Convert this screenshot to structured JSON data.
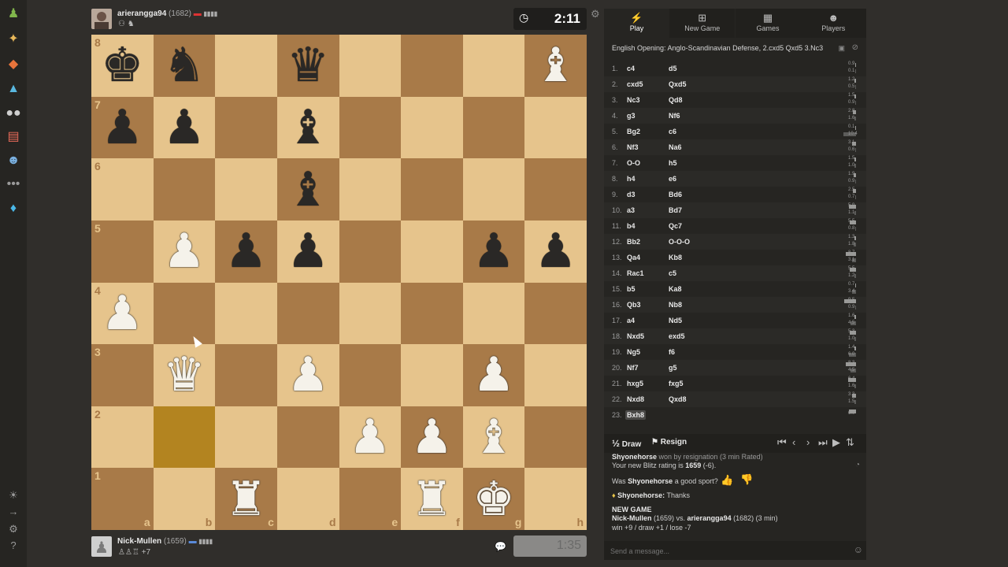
{
  "sidebar": {
    "icons": [
      "pawn-icon",
      "puzzle-icon",
      "lessons-icon",
      "learn-icon",
      "watch-icon",
      "news-icon",
      "social-icon",
      "more-icon",
      "diamond-icon",
      "theme-icon",
      "collapse-icon",
      "settings-icon",
      "help-icon"
    ],
    "colors": {
      "pawn": "#81b64c",
      "puzzle": "#e8b85a",
      "lessons": "#e8743b",
      "learn": "#5ab8e0",
      "diamond": "#4ab8e8"
    }
  },
  "top_player": {
    "name": "arierangga94",
    "rating": "(1682)",
    "clock": "2:11"
  },
  "bottom_player": {
    "name": "Nick-Mullen",
    "rating": "(1659)",
    "extra": "+7",
    "clock": "1:35"
  },
  "board": {
    "files": [
      "a",
      "b",
      "c",
      "d",
      "e",
      "f",
      "g",
      "h"
    ],
    "ranks": [
      "8",
      "7",
      "6",
      "5",
      "4",
      "3",
      "2",
      "1"
    ],
    "light_color": "#e6c48c",
    "dark_color": "#a87a48",
    "position": [
      [
        "k",
        "n",
        "",
        "q",
        "",
        "",
        "",
        "B"
      ],
      [
        "p",
        "p",
        "",
        "b",
        "",
        "",
        "",
        ""
      ],
      [
        "",
        "",
        "",
        "b",
        "",
        "",
        "",
        ""
      ],
      [
        "",
        "P",
        "p",
        "p",
        "",
        "",
        "p",
        "p"
      ],
      [
        "P",
        "",
        "",
        "",
        "",
        "",
        "",
        ""
      ],
      [
        "",
        "Q",
        "",
        "P",
        "",
        "",
        "P",
        ""
      ],
      [
        "",
        "",
        "",
        "",
        "P",
        "P",
        "B",
        ""
      ],
      [
        "",
        "",
        "R",
        "",
        "",
        "R",
        "K",
        ""
      ]
    ],
    "highlight_square": "b2"
  },
  "tabs": [
    {
      "label": "Play",
      "icon": "lightning-icon",
      "active": true
    },
    {
      "label": "New Game",
      "icon": "plus-icon",
      "active": false
    },
    {
      "label": "Games",
      "icon": "board-icon",
      "active": false
    },
    {
      "label": "Players",
      "icon": "players-icon",
      "active": false
    }
  ],
  "opening": "English Opening: Anglo-Scandinavian Defense, 2.cxd5 Qxd5 3.Nc3",
  "moves": [
    {
      "n": "1.",
      "w": "c4",
      "b": "d5",
      "tw": "0.9",
      "tb": "0.1"
    },
    {
      "n": "2.",
      "w": "cxd5",
      "b": "Qxd5",
      "tw": "1.2",
      "tb": "0.5"
    },
    {
      "n": "3.",
      "w": "Nc3",
      "b": "Qd8",
      "tw": "1.5",
      "tb": "0.9"
    },
    {
      "n": "4.",
      "w": "g3",
      "b": "Nf6",
      "tw": "2.8",
      "tb": "1.6"
    },
    {
      "n": "5.",
      "w": "Bg2",
      "b": "c6",
      "tw": "0.1",
      "tb": "10.4"
    },
    {
      "n": "6.",
      "w": "Nf3",
      "b": "Na6",
      "tw": "3.1",
      "tb": "0.6"
    },
    {
      "n": "7.",
      "w": "O-O",
      "b": "h5",
      "tw": "1.5",
      "tb": "1.0"
    },
    {
      "n": "8.",
      "w": "h4",
      "b": "e6",
      "tw": "1.9",
      "tb": "0.9"
    },
    {
      "n": "9.",
      "w": "d3",
      "b": "Bd6",
      "tw": "2.5",
      "tb": "0.7"
    },
    {
      "n": "10.",
      "w": "a3",
      "b": "Bd7",
      "tw": "5.9",
      "tb": "1.1"
    },
    {
      "n": "11.",
      "w": "b4",
      "b": "Qc7",
      "tw": "5.5",
      "tb": "0.8"
    },
    {
      "n": "12.",
      "w": "Bb2",
      "b": "O-O-O",
      "tw": "1.3",
      "tb": "1.8"
    },
    {
      "n": "13.",
      "w": "Qa4",
      "b": "Kb8",
      "tw": "8.7",
      "tb": "3.1"
    },
    {
      "n": "14.",
      "w": "Rac1",
      "b": "c5",
      "tw": "5.5",
      "tb": "1.2"
    },
    {
      "n": "15.",
      "w": "b5",
      "b": "Ka8",
      "tw": "0.7",
      "tb": "3.4"
    },
    {
      "n": "16.",
      "w": "Qb3",
      "b": "Nb8",
      "tw": "9.5",
      "tb": "0.9"
    },
    {
      "n": "17.",
      "w": "a4",
      "b": "Nd5",
      "tw": "1.6",
      "tb": "4.5"
    },
    {
      "n": "18.",
      "w": "Nxd5",
      "b": "exd5",
      "tw": "5.3",
      "tb": "1.0"
    },
    {
      "n": "19.",
      "w": "Ng5",
      "b": "f6",
      "tw": "1.4",
      "tb": "6.0"
    },
    {
      "n": "20.",
      "w": "Nf7",
      "b": "g5",
      "tw": "8.3",
      "tb": "4.5"
    },
    {
      "n": "21.",
      "w": "hxg5",
      "b": "fxg5",
      "tw": "6.4",
      "tb": "1.6"
    },
    {
      "n": "22.",
      "w": "Nxd8",
      "b": "Qxd8",
      "tw": "3.3",
      "tb": "1.5"
    },
    {
      "n": "23.",
      "w": "Bxh8",
      "b": "",
      "tw": "6.0",
      "tb": ""
    }
  ],
  "controls": {
    "draw_symbol": "½",
    "draw": "Draw",
    "resign": "Resign"
  },
  "chat": {
    "result_name": "Shyonehorse",
    "result_rest": " won by resignation (3 min Rated)",
    "rating_prefix": "Your new Blitz rating is ",
    "rating_value": "1659",
    "rating_suffix": " (-6).",
    "sport_prefix": "Was ",
    "sport_name": "Shyonehorse",
    "sport_suffix": " a good sport?",
    "msg_name": "Shyonehorse:",
    "msg_text": " Thanks",
    "new_game": "NEW GAME",
    "ng_white": "Nick-Mullen",
    "ng_white_rating": " (1659) vs. ",
    "ng_black": "arierangga94",
    "ng_black_rating": " (1682) (3 min)",
    "ng_odds": "win +9 / draw +1 / lose -7",
    "placeholder": "Send a message..."
  }
}
